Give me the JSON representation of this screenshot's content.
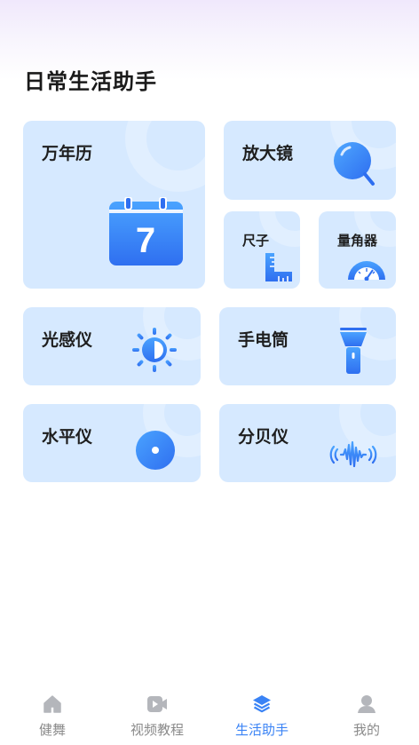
{
  "page": {
    "title": "日常生活助手"
  },
  "tools": {
    "calendar": {
      "label": "万年历",
      "day": "7"
    },
    "magnifier": {
      "label": "放大镜"
    },
    "ruler": {
      "label": "尺子"
    },
    "protractor": {
      "label": "量角器"
    },
    "light_meter": {
      "label": "光感仪"
    },
    "flashlight": {
      "label": "手电筒"
    },
    "level": {
      "label": "水平仪"
    },
    "decibel": {
      "label": "分贝仪"
    }
  },
  "tabbar": {
    "items": [
      {
        "label": "健舞",
        "icon": "home-icon",
        "active": false
      },
      {
        "label": "视频教程",
        "icon": "video-icon",
        "active": false
      },
      {
        "label": "生活助手",
        "icon": "layers-icon",
        "active": true
      },
      {
        "label": "我的",
        "icon": "user-icon",
        "active": false
      }
    ]
  },
  "colors": {
    "card_bg": "#d6e9ff",
    "accent": "#3a83f5",
    "tab_inactive": "#8a8a8a"
  }
}
